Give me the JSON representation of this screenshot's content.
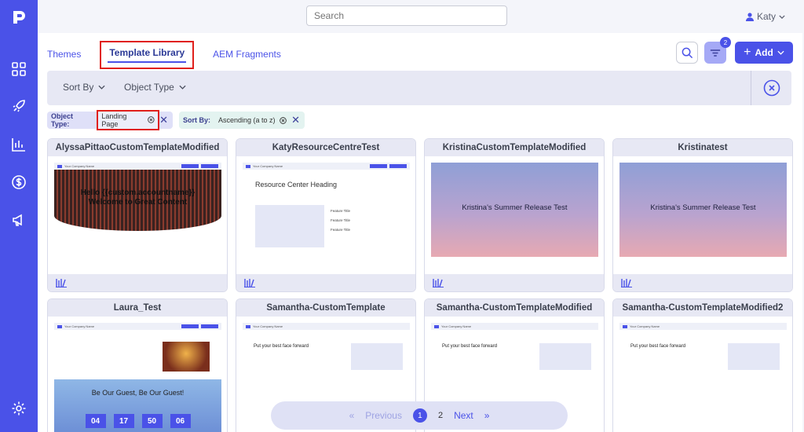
{
  "search": {
    "placeholder": "Search"
  },
  "user": {
    "name": "Katy"
  },
  "tabs": [
    {
      "label": "Themes"
    },
    {
      "label": "Template Library"
    },
    {
      "label": "AEM Fragments"
    }
  ],
  "toolbar": {
    "filter_count": "2",
    "add_label": "Add"
  },
  "filters": {
    "sort_by": "Sort By",
    "object_type": "Object Type"
  },
  "chips": {
    "object_type_label": "Object Type:",
    "object_type_value": "Landing Page",
    "sort_by_label": "Sort By:",
    "sort_by_value": "Ascending (a to z)"
  },
  "templates": [
    {
      "title": "AlyssaPittaoCustomTemplateModified",
      "hero_line1": "Hello {{custom.accountname}}",
      "hero_line2": "Welcome to Great Content"
    },
    {
      "title": "KatyResourceCentreTest",
      "heading": "Resource Center Heading",
      "feature": "Feature Title"
    },
    {
      "title": "KristinaCustomTemplateModified",
      "hero": "Kristina's Summer Release Test"
    },
    {
      "title": "Kristinatest",
      "hero": "Kristina's Summer Release Test"
    },
    {
      "title": "Laura_Test",
      "hero": "Be Our Guest, Be Our Guest!",
      "countdown": [
        "04",
        "17",
        "50",
        "06"
      ]
    },
    {
      "title": "Samantha-CustomTemplate",
      "heading": "Put your best face forward"
    },
    {
      "title": "Samantha-CustomTemplateModified",
      "heading": "Put your best face forward"
    },
    {
      "title": "Samantha-CustomTemplateModified2",
      "heading": "Put your best face forward"
    }
  ],
  "mini": {
    "company": "Your Company Name"
  },
  "pagination": {
    "previous": "Previous",
    "current": "1",
    "next_page": "2",
    "next": "Next"
  },
  "colors": {
    "accent": "#4a52e8",
    "highlight": "#e0201b"
  }
}
